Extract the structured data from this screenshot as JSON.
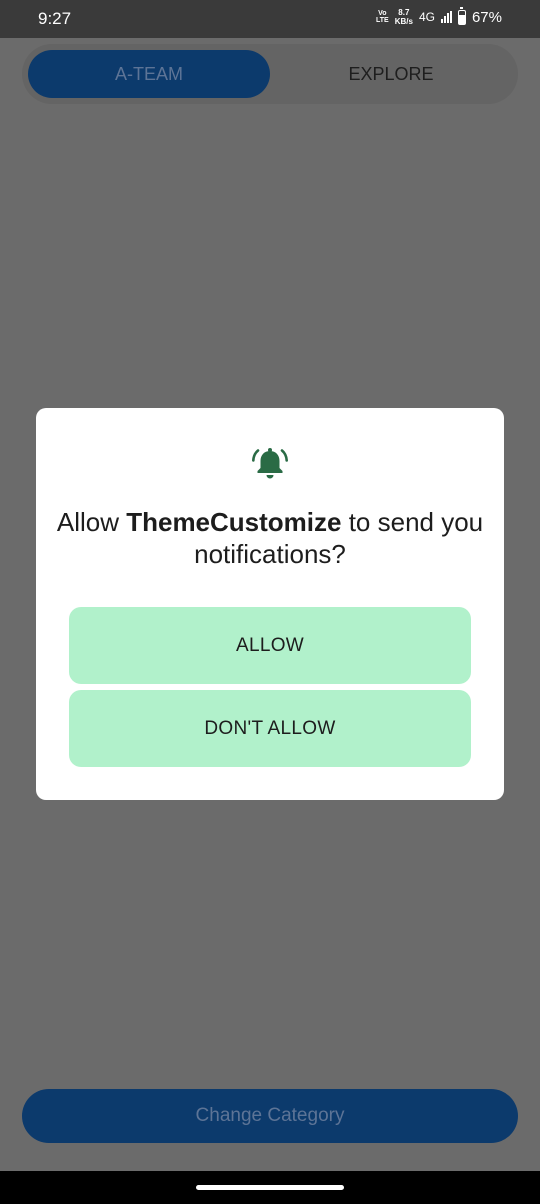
{
  "status_bar": {
    "time": "9:27",
    "volte_line1": "Vo",
    "volte_line2": "LTE",
    "speed_value": "8.7",
    "speed_unit": "KB/s",
    "network": "4G",
    "battery_percent": "67%",
    "battery_level": 0.67
  },
  "tabs": [
    {
      "label": "A-TEAM",
      "selected": true
    },
    {
      "label": "EXPLORE",
      "selected": false
    }
  ],
  "dialog": {
    "icon": "bell-ringing-icon",
    "prompt_prefix": "Allow ",
    "app_name": "ThemeCustomize",
    "prompt_suffix": " to send you notifications?",
    "allow_label": "ALLOW",
    "deny_label": "DON'T ALLOW"
  },
  "bottom": {
    "change_category_label": "Change Category"
  },
  "colors": {
    "scrim": "#6b6b6b",
    "accent_green": "#2a6b45",
    "button_green": "#b1f1cb",
    "primary_blue": "#0c3a6c"
  }
}
